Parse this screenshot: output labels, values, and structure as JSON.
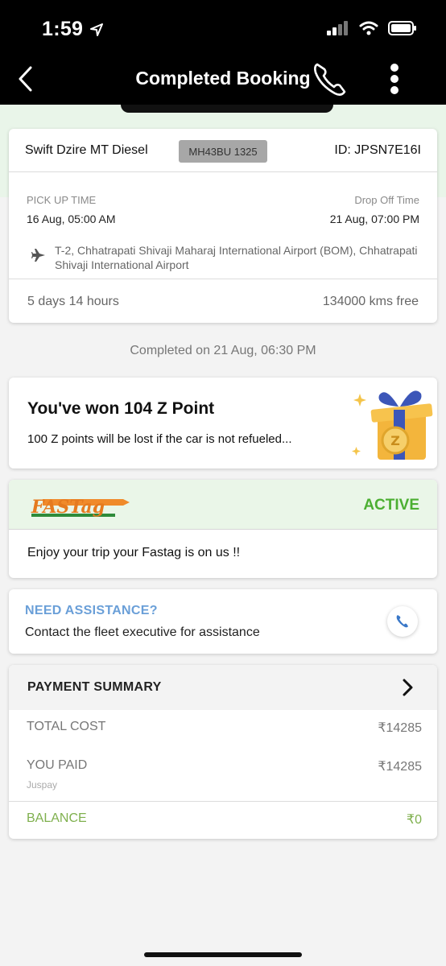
{
  "status_bar": {
    "time": "1:59"
  },
  "header": {
    "title": "Completed Booking"
  },
  "booking": {
    "car_name": "Swift Dzire MT Diesel",
    "plate": "MH43BU 1325",
    "booking_id": "ID: JPSN7E16I",
    "pickup_label": "PICK UP TIME",
    "pickup_value": "16 Aug, 05:00 AM",
    "dropoff_label": "Drop Off Time",
    "dropoff_value": "21 Aug, 07:00 PM",
    "address": "T-2, Chhatrapati Shivaji Maharaj International Airport (BOM), Chhatrapati Shivaji International Airport",
    "duration": "5 days 14 hours",
    "kms": "134000 kms free"
  },
  "completed_on": "Completed on 21 Aug, 06:30 PM",
  "reward": {
    "title": "You've won 104 Z Point",
    "description": "100 Z points will be lost if the car is not refueled..."
  },
  "fastag": {
    "logo_text": "FASTag",
    "status": "ACTIVE",
    "message": "Enjoy your trip your Fastag is on us !!"
  },
  "assistance": {
    "title": "NEED ASSISTANCE?",
    "description": "Contact the fleet executive for assistance"
  },
  "payment": {
    "title": "PAYMENT SUMMARY",
    "total_label": "TOTAL COST",
    "total_value": "₹14285",
    "paid_label": "YOU PAID",
    "paid_value": "₹14285",
    "paid_via": "Juspay",
    "balance_label": "BALANCE",
    "balance_value": "₹0"
  },
  "colors": {
    "header_bg": "#000000",
    "accent_green": "#4caf32",
    "assist_blue": "#6a9fd8",
    "balance_green": "#7fb04e"
  }
}
